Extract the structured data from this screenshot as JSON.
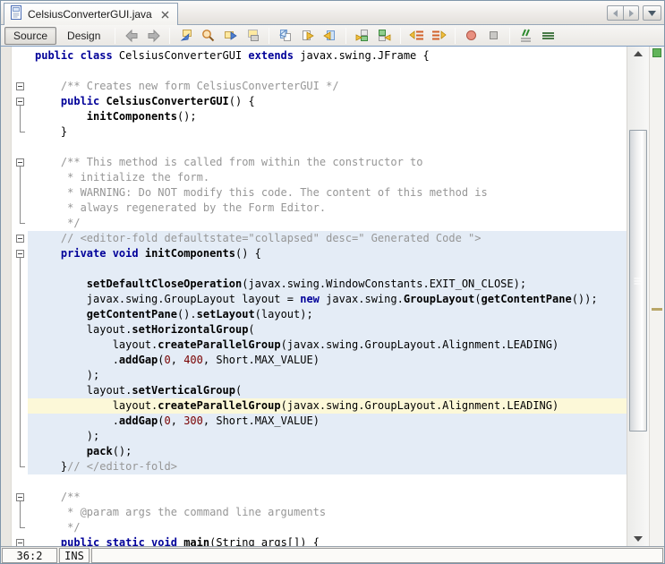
{
  "tab_bar": {
    "tabs": [
      {
        "title": "CelsiusConverterGUI.java",
        "active": true,
        "icon": "java-file-icon",
        "close": "close-icon"
      }
    ],
    "controls": {
      "scroll_left": "left-arrow-icon",
      "scroll_right": "right-arrow-icon",
      "tab_list": "down-arrow-icon"
    }
  },
  "toolbar": {
    "view_buttons": [
      {
        "label": "Source",
        "selected": true
      },
      {
        "label": "Design",
        "selected": false
      }
    ],
    "icon_buttons": [
      "back",
      "forward",
      "last-edit-location",
      "find-selection",
      "find-next-occurrence",
      "toggle-highlight-search",
      "previous-bookmark",
      "next-bookmark",
      "toggle-bookmark",
      "next-usage",
      "previous-usage",
      "shift-line-left",
      "shift-line-right",
      "start-macro-recording",
      "stop-macro-recording",
      "comment",
      "uncomment"
    ]
  },
  "editor": {
    "lines": [
      {
        "bg": "",
        "fold": "",
        "segs": [
          [
            "kw",
            "public class"
          ],
          [
            "pl",
            " CelsiusConverterGUI "
          ],
          [
            "kw",
            "extends"
          ],
          [
            "pl",
            " javax.swing.JFrame {"
          ]
        ]
      },
      {
        "bg": "",
        "fold": "",
        "segs": []
      },
      {
        "bg": "",
        "fold": "box",
        "segs": [
          [
            "cm",
            "    /** Creates new form CelsiusConverterGUI */"
          ]
        ]
      },
      {
        "bg": "",
        "fold": "boxline",
        "segs": [
          [
            "pl",
            "    "
          ],
          [
            "kw",
            "public"
          ],
          [
            "pl",
            " "
          ],
          [
            "mt",
            "CelsiusConverterGUI"
          ],
          [
            "pl",
            "() {"
          ]
        ]
      },
      {
        "bg": "",
        "fold": "line",
        "segs": [
          [
            "pl",
            "        "
          ],
          [
            "mt",
            "initComponents"
          ],
          [
            "pl",
            "();"
          ]
        ]
      },
      {
        "bg": "",
        "fold": "end",
        "segs": [
          [
            "pl",
            "    }"
          ]
        ]
      },
      {
        "bg": "",
        "fold": "",
        "segs": []
      },
      {
        "bg": "",
        "fold": "boxline",
        "segs": [
          [
            "cm",
            "    /** This method is called from within the constructor to"
          ]
        ]
      },
      {
        "bg": "",
        "fold": "line",
        "segs": [
          [
            "cm",
            "     * initialize the form."
          ]
        ]
      },
      {
        "bg": "",
        "fold": "line",
        "segs": [
          [
            "cm",
            "     * WARNING: Do NOT modify this code. The content of this method is"
          ]
        ]
      },
      {
        "bg": "",
        "fold": "line",
        "segs": [
          [
            "cm",
            "     * always regenerated by the Form Editor."
          ]
        ]
      },
      {
        "bg": "",
        "fold": "end",
        "segs": [
          [
            "cm",
            "     */"
          ]
        ]
      },
      {
        "bg": "sel",
        "fold": "box",
        "segs": [
          [
            "cm",
            "    // <editor-fold defaultstate=\"collapsed\" desc=\" Generated Code \">"
          ]
        ]
      },
      {
        "bg": "sel",
        "fold": "boxline",
        "segs": [
          [
            "pl",
            "    "
          ],
          [
            "kw",
            "private void"
          ],
          [
            "pl",
            " "
          ],
          [
            "mt",
            "initComponents"
          ],
          [
            "pl",
            "() {"
          ]
        ]
      },
      {
        "bg": "sel",
        "fold": "line",
        "segs": []
      },
      {
        "bg": "sel",
        "fold": "line",
        "segs": [
          [
            "pl",
            "        "
          ],
          [
            "mt",
            "setDefaultCloseOperation"
          ],
          [
            "pl",
            "(javax.swing.WindowConstants.EXIT_ON_CLOSE);"
          ]
        ]
      },
      {
        "bg": "sel",
        "fold": "line",
        "segs": [
          [
            "pl",
            "        javax.swing.GroupLayout layout = "
          ],
          [
            "kw",
            "new"
          ],
          [
            "pl",
            " javax.swing."
          ],
          [
            "mt",
            "GroupLayout"
          ],
          [
            "pl",
            "("
          ],
          [
            "mt",
            "getContentPane"
          ],
          [
            "pl",
            "());"
          ]
        ]
      },
      {
        "bg": "sel",
        "fold": "line",
        "segs": [
          [
            "pl",
            "        "
          ],
          [
            "mt",
            "getContentPane"
          ],
          [
            "pl",
            "()."
          ],
          [
            "mt",
            "setLayout"
          ],
          [
            "pl",
            "(layout);"
          ]
        ]
      },
      {
        "bg": "sel",
        "fold": "line",
        "segs": [
          [
            "pl",
            "        layout."
          ],
          [
            "mt",
            "setHorizontalGroup"
          ],
          [
            "pl",
            "("
          ]
        ]
      },
      {
        "bg": "sel",
        "fold": "line",
        "segs": [
          [
            "pl",
            "            layout."
          ],
          [
            "mt",
            "createParallelGroup"
          ],
          [
            "pl",
            "(javax.swing.GroupLayout.Alignment.LEADING)"
          ]
        ]
      },
      {
        "bg": "sel",
        "fold": "line",
        "segs": [
          [
            "pl",
            "            ."
          ],
          [
            "mt",
            "addGap"
          ],
          [
            "pl",
            "("
          ],
          [
            "nm",
            "0"
          ],
          [
            "pl",
            ", "
          ],
          [
            "nm",
            "400"
          ],
          [
            "pl",
            ", Short.MAX_VALUE)"
          ]
        ]
      },
      {
        "bg": "sel",
        "fold": "line",
        "segs": [
          [
            "pl",
            "        );"
          ]
        ]
      },
      {
        "bg": "sel",
        "fold": "line",
        "segs": [
          [
            "pl",
            "        layout."
          ],
          [
            "mt",
            "setVerticalGroup"
          ],
          [
            "pl",
            "("
          ]
        ]
      },
      {
        "bg": "cur",
        "fold": "line",
        "segs": [
          [
            "pl",
            "            layout."
          ],
          [
            "mt",
            "createParallelGroup"
          ],
          [
            "pl",
            "(javax.swing.GroupLayout.Alignment.LEADING)"
          ]
        ]
      },
      {
        "bg": "sel",
        "fold": "line",
        "segs": [
          [
            "pl",
            "            ."
          ],
          [
            "mt",
            "addGap"
          ],
          [
            "pl",
            "("
          ],
          [
            "nm",
            "0"
          ],
          [
            "pl",
            ", "
          ],
          [
            "nm",
            "300"
          ],
          [
            "pl",
            ", Short.MAX_VALUE)"
          ]
        ]
      },
      {
        "bg": "sel",
        "fold": "line",
        "segs": [
          [
            "pl",
            "        );"
          ]
        ]
      },
      {
        "bg": "sel",
        "fold": "line",
        "segs": [
          [
            "pl",
            "        "
          ],
          [
            "mt",
            "pack"
          ],
          [
            "pl",
            "();"
          ]
        ]
      },
      {
        "bg": "sel",
        "fold": "end",
        "segs": [
          [
            "pl",
            "    }"
          ],
          [
            "cm",
            "// </editor-fold>"
          ]
        ]
      },
      {
        "bg": "",
        "fold": "",
        "segs": []
      },
      {
        "bg": "",
        "fold": "boxline",
        "segs": [
          [
            "cm",
            "    /**"
          ]
        ]
      },
      {
        "bg": "",
        "fold": "line",
        "segs": [
          [
            "cm",
            "     * @param args the command line arguments"
          ]
        ]
      },
      {
        "bg": "",
        "fold": "end",
        "segs": [
          [
            "cm",
            "     */"
          ]
        ]
      },
      {
        "bg": "",
        "fold": "boxline",
        "segs": [
          [
            "pl",
            "    "
          ],
          [
            "kw",
            "public static void"
          ],
          [
            "pl",
            " "
          ],
          [
            "mt",
            "main"
          ],
          [
            "pl",
            "(String args[]) {"
          ]
        ]
      }
    ]
  },
  "status_bar": {
    "caret_position": "36:2",
    "insert_mode": "INS"
  },
  "colors": {
    "keyword": "#000099",
    "comment": "#969696",
    "number": "#780000",
    "guarded_block_bg": "#e4ecf6",
    "current_line_bg": "#fcf8d8",
    "error_stripe_ok": "#62b45a",
    "error_stripe_caret_mark": "#b9a668"
  }
}
